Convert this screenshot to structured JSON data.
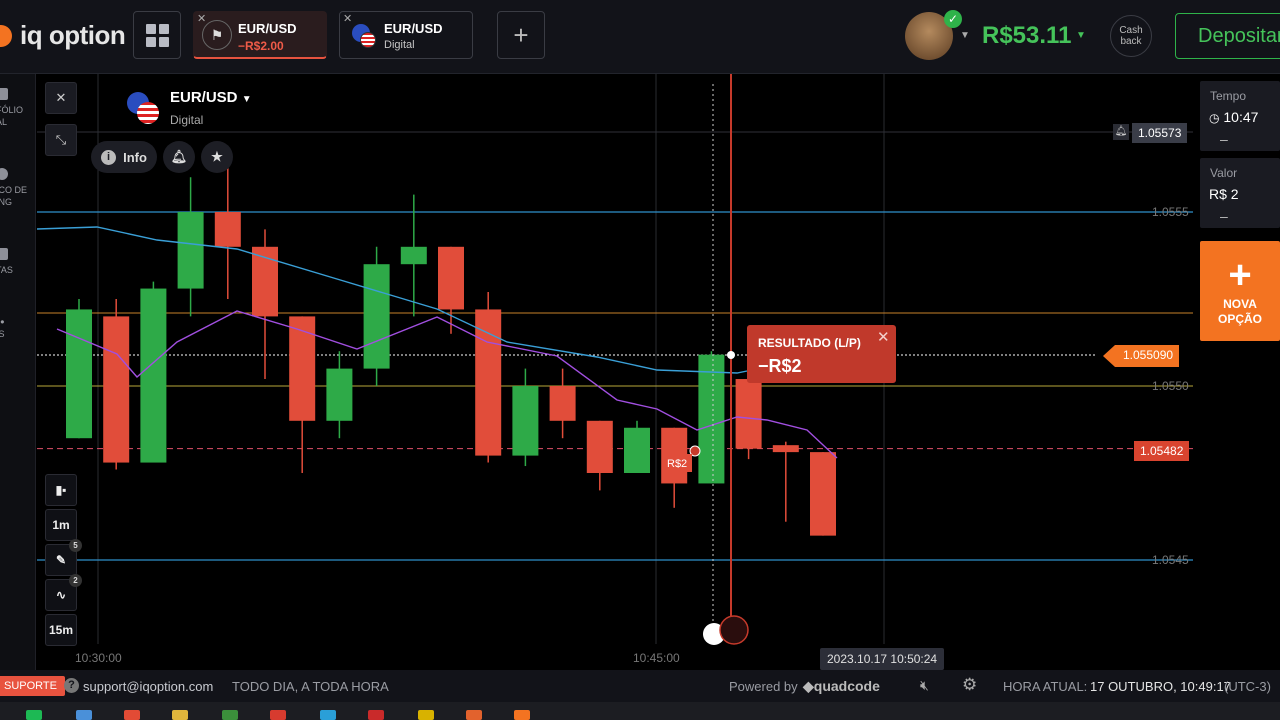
{
  "brand": {
    "name": "iq option"
  },
  "tabs": [
    {
      "pair": "EUR/USD",
      "sub": "−R$2.00",
      "active": true
    },
    {
      "pair": "EUR/USD",
      "sub": "Digital",
      "active": false
    }
  ],
  "header": {
    "balance": "R$53.11",
    "cashback": "Cash back",
    "deposit": "Depositar"
  },
  "sidebar": {
    "items": [
      {
        "label": "FÓLIO\nAL"
      },
      {
        "label": "ICO DE\nING"
      },
      {
        "label": "TAS"
      },
      {
        "label": "IS"
      }
    ]
  },
  "asset": {
    "name": "EUR/USD",
    "type": "Digital",
    "info_label": "Info"
  },
  "chart": {
    "price_labels": [
      "1.0555",
      "1.0550",
      "1.0545"
    ],
    "time_labels": [
      "10:30:00",
      "10:45:00"
    ],
    "top_price": "1.05573",
    "current_price": "1.055090",
    "strike_price": "1.05482",
    "cursor_time": "2023.10.17 10:50:24",
    "trade_amount_label": "R$2",
    "tool_labels": {
      "timeframe": "1m",
      "interval": "15m",
      "draw_count": "5",
      "indicator_count": "2"
    }
  },
  "chart_data": {
    "type": "candlestick",
    "title": "",
    "xlabel": "",
    "ylabel": "",
    "x_ticks": [
      "10:30:00",
      "10:45:00"
    ],
    "y_ticks": [
      1.0555,
      1.055,
      1.0545
    ],
    "candles": [
      {
        "o": 1.05485,
        "h": 1.05525,
        "l": 1.05485,
        "c": 1.05522,
        "color": "up"
      },
      {
        "o": 1.0552,
        "h": 1.05525,
        "l": 1.05476,
        "c": 1.05478,
        "color": "down"
      },
      {
        "o": 1.05478,
        "h": 1.0553,
        "l": 1.05478,
        "c": 1.05528,
        "color": "up"
      },
      {
        "o": 1.05528,
        "h": 1.0556,
        "l": 1.0552,
        "c": 1.0555,
        "color": "up"
      },
      {
        "o": 1.0555,
        "h": 1.05565,
        "l": 1.05525,
        "c": 1.0554,
        "color": "down"
      },
      {
        "o": 1.0554,
        "h": 1.05545,
        "l": 1.05502,
        "c": 1.0552,
        "color": "down"
      },
      {
        "o": 1.0552,
        "h": 1.0552,
        "l": 1.05475,
        "c": 1.0549,
        "color": "down"
      },
      {
        "o": 1.0549,
        "h": 1.0551,
        "l": 1.05485,
        "c": 1.05505,
        "color": "up"
      },
      {
        "o": 1.05505,
        "h": 1.0554,
        "l": 1.055,
        "c": 1.05535,
        "color": "up"
      },
      {
        "o": 1.05535,
        "h": 1.05555,
        "l": 1.0552,
        "c": 1.0554,
        "color": "up"
      },
      {
        "o": 1.0554,
        "h": 1.0554,
        "l": 1.05515,
        "c": 1.05522,
        "color": "down"
      },
      {
        "o": 1.05522,
        "h": 1.05527,
        "l": 1.05478,
        "c": 1.0548,
        "color": "down"
      },
      {
        "o": 1.0548,
        "h": 1.05505,
        "l": 1.05477,
        "c": 1.055,
        "color": "up"
      },
      {
        "o": 1.055,
        "h": 1.05505,
        "l": 1.05485,
        "c": 1.0549,
        "color": "down"
      },
      {
        "o": 1.0549,
        "h": 1.0549,
        "l": 1.0547,
        "c": 1.05475,
        "color": "down"
      },
      {
        "o": 1.05475,
        "h": 1.0549,
        "l": 1.05475,
        "c": 1.05488,
        "color": "up"
      },
      {
        "o": 1.05488,
        "h": 1.05488,
        "l": 1.05465,
        "c": 1.05472,
        "color": "down"
      },
      {
        "o": 1.05472,
        "h": 1.0551,
        "l": 1.05472,
        "c": 1.05509,
        "color": "up"
      },
      {
        "o": 1.05502,
        "h": 1.05516,
        "l": 1.05479,
        "c": 1.05482,
        "color": "down"
      },
      {
        "o": 1.05483,
        "h": 1.05484,
        "l": 1.05461,
        "c": 1.05481,
        "color": "down"
      },
      {
        "o": 1.05481,
        "h": 1.05481,
        "l": 1.05457,
        "c": 1.05457,
        "color": "down"
      }
    ]
  },
  "result": {
    "title": "RESULTADO (L/P)",
    "value": "−R$2"
  },
  "rightpanel": {
    "time_label": "Tempo",
    "time_value": "10:47",
    "amount_label": "Valor",
    "amount_value": "R$ 2",
    "new_option": "NOVA OPÇÃO"
  },
  "footer": {
    "support": "SUPORTE",
    "email": "support@iqoption.com",
    "tagline": "TODO DIA, A TODA HORA",
    "powered": "Powered by",
    "powered_brand": "quadcode",
    "current_time_label": "HORA ATUAL:",
    "current_time": "17 OUTUBRO, 10:49:17",
    "timezone": "(UTC-3)"
  },
  "colors": {
    "up": "#2eaa48",
    "down": "#e14d3a",
    "accent": "#f37321",
    "balance": "#45c35a"
  }
}
